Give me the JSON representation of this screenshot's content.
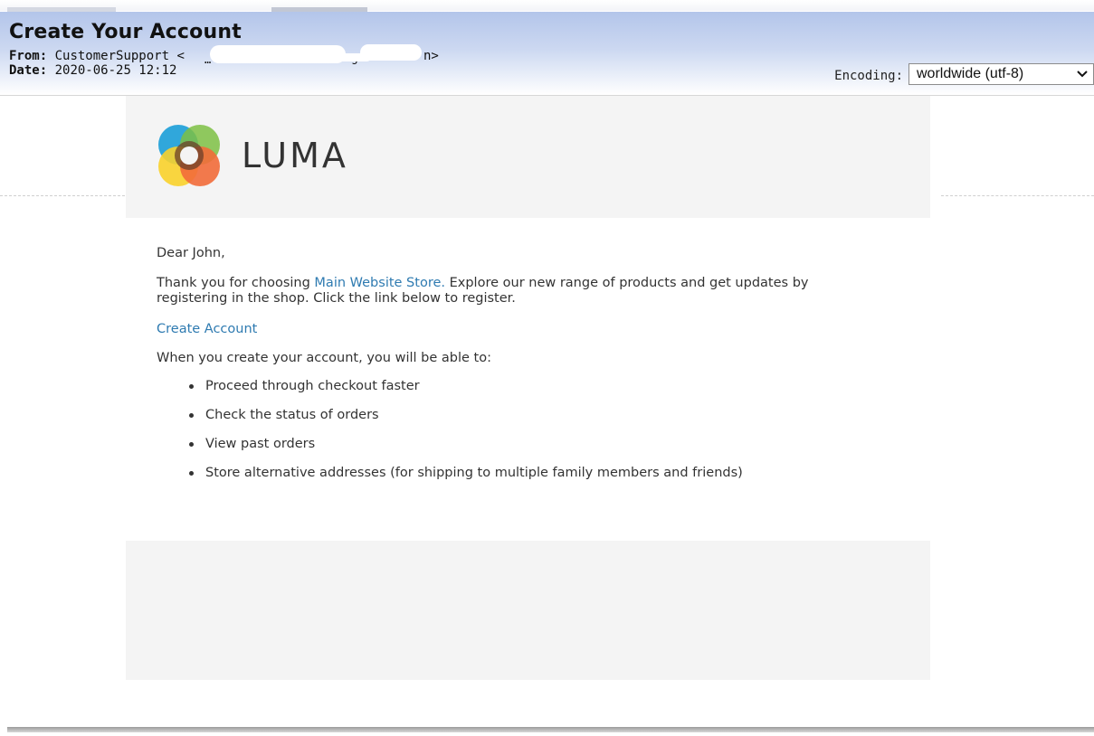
{
  "header": {
    "subject": "Create Your Account",
    "from_label": "From:",
    "from_value": "CustomerSupport <",
    "from_fragment_1": "…",
    "from_fragment_2": "g",
    "from_end": "n>",
    "date_label": "Date:",
    "date_value": "2020-06-25 12:12",
    "encoding_label": "Encoding:",
    "encoding_value": "worldwide (utf-8)"
  },
  "email": {
    "logo_text": "LUMA",
    "logo_icon": "luma-logo-icon",
    "greeting": "Dear John,",
    "intro_before": "Thank you for choosing ",
    "store_link": "Main Website Store.",
    "intro_after": " Explore our new range of products and get updates by registering in the shop. Click the link below to register.",
    "create_account_link": "Create Account",
    "able_text": "When you create your account, you will be able to:",
    "benefits": [
      "Proceed through checkout faster",
      "Check the status of orders",
      "View past orders",
      "Store alternative addresses (for shipping to multiple family members and friends)"
    ]
  },
  "colors": {
    "link": "#2f7bb1",
    "band_gray": "#f4f4f4",
    "header_blue": "#b3c5ea"
  }
}
